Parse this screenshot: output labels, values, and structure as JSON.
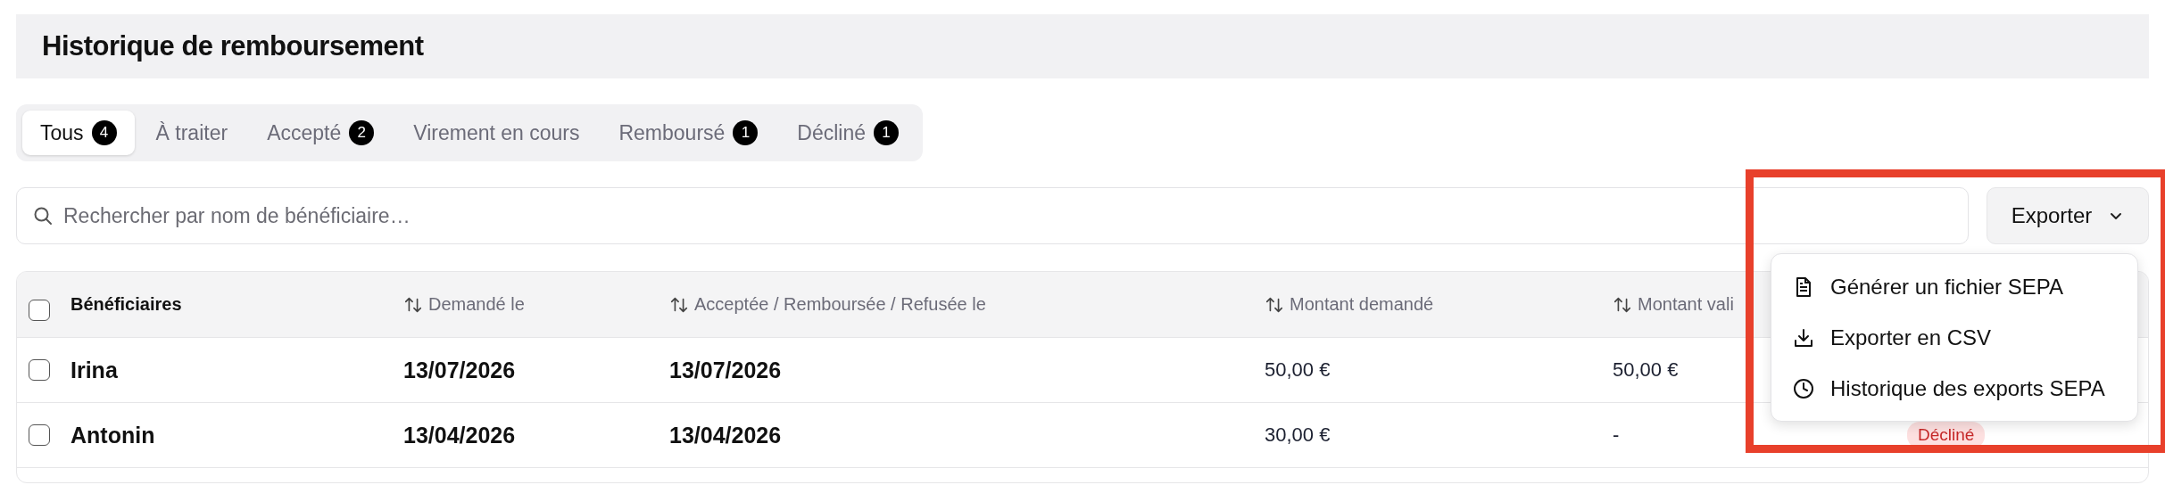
{
  "header": {
    "title": "Historique de remboursement"
  },
  "tabs": [
    {
      "label": "Tous",
      "count": "4",
      "selected": true
    },
    {
      "label": "À traiter",
      "selected": false
    },
    {
      "label": "Accepté",
      "count": "2",
      "selected": false
    },
    {
      "label": "Virement en cours",
      "selected": false
    },
    {
      "label": "Remboursé",
      "count": "1",
      "selected": false
    },
    {
      "label": "Décliné",
      "count": "1",
      "selected": false
    }
  ],
  "search": {
    "placeholder": "Rechercher par nom de bénéficiaire…"
  },
  "export_button": {
    "label": "Exporter"
  },
  "export_menu": [
    {
      "label": "Générer un fichier SEPA"
    },
    {
      "label": "Exporter en CSV"
    },
    {
      "label": "Historique des exports SEPA"
    }
  ],
  "table": {
    "select_all_checked": false,
    "columns": [
      {
        "label": "Bénéficiaires"
      },
      {
        "label": "Demandé le"
      },
      {
        "label": "Acceptée / Remboursée / Refusée le"
      },
      {
        "label": "Montant demandé"
      },
      {
        "label": "Montant vali"
      }
    ],
    "rows": [
      {
        "checked": false,
        "cells": [
          "Irina",
          "13/07/2026",
          "13/07/2026",
          "50,00 €",
          "50,00 €"
        ]
      },
      {
        "checked": false,
        "cells": [
          "Antonin",
          "13/04/2026",
          "13/04/2026",
          "30,00 €",
          "-"
        ],
        "status": "Décliné"
      }
    ]
  }
}
